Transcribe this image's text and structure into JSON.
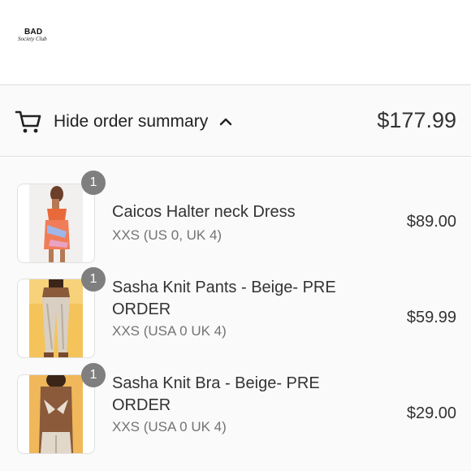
{
  "header": {
    "logo_text": "BAD",
    "logo_script": "Society Club"
  },
  "summary": {
    "toggle_label": "Hide order summary",
    "total": "$177.99",
    "icons": {
      "cart": "cart-icon",
      "chevron": "chevron-up-icon"
    }
  },
  "items": [
    {
      "quantity": "1",
      "name": "Caicos Halter neck Dress",
      "variant": "XXS (US 0, UK 4)",
      "price": "$89.00"
    },
    {
      "quantity": "1",
      "name": "Sasha Knit Pants - Beige- PRE ORDER",
      "variant": "XXS (USA 0 UK 4)",
      "price": "$59.99"
    },
    {
      "quantity": "1",
      "name": "Sasha Knit Bra - Beige- PRE ORDER",
      "variant": "XXS (USA 0 UK 4)",
      "price": "$29.00"
    }
  ],
  "colors": {
    "badge": "#7f7f7f",
    "panel": "#fafafa",
    "border": "#dedede",
    "muted_text": "#737373"
  }
}
